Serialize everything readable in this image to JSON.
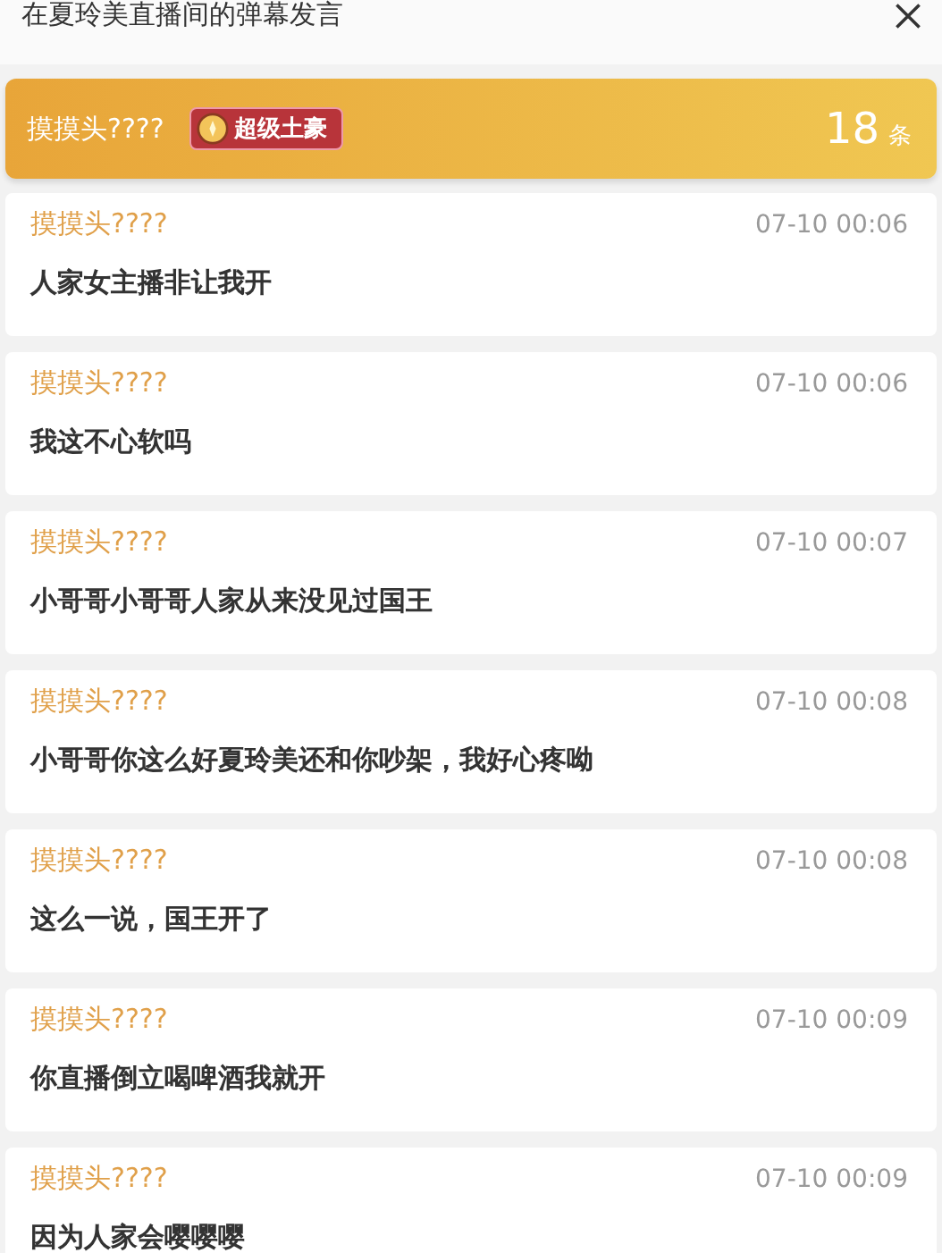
{
  "title": "在夏玲美直播间的弹幕发言",
  "summary": {
    "user": "摸摸头????",
    "badge": "超级土豪",
    "count": "18",
    "count_unit": "条"
  },
  "messages": [
    {
      "user": "摸摸头????",
      "time": "07-10 00:06",
      "text": "人家女主播非让我开"
    },
    {
      "user": "摸摸头????",
      "time": "07-10 00:06",
      "text": "我这不心软吗"
    },
    {
      "user": "摸摸头????",
      "time": "07-10 00:07",
      "text": "小哥哥小哥哥人家从来没见过国王"
    },
    {
      "user": "摸摸头????",
      "time": "07-10 00:08",
      "text": "小哥哥你这么好夏玲美还和你吵架，我好心疼呦"
    },
    {
      "user": "摸摸头????",
      "time": "07-10 00:08",
      "text": "这么一说，国王开了"
    },
    {
      "user": "摸摸头????",
      "time": "07-10 00:09",
      "text": "你直播倒立喝啤酒我就开"
    },
    {
      "user": "摸摸头????",
      "time": "07-10 00:09",
      "text": "因为人家会嘤嘤嘤"
    }
  ]
}
